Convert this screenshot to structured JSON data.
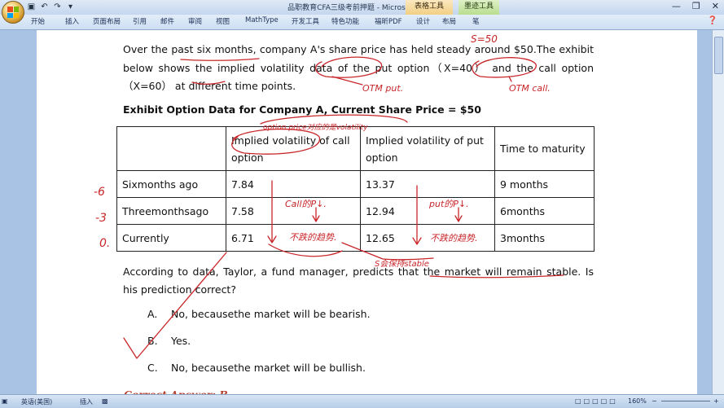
{
  "window": {
    "title": "品职教育CFA三级考前押题 - Microsoft Word",
    "contextual_tabs": [
      "表格工具",
      "墨迹工具"
    ]
  },
  "ribbon": {
    "tabs": [
      "开始",
      "插入",
      "页面布局",
      "引用",
      "邮件",
      "审阅",
      "视图",
      "MathType",
      "开发工具",
      "特色功能",
      "福昕PDF",
      "设计",
      "布局",
      "笔"
    ]
  },
  "document": {
    "para1": "Over the past six months, company A's share price has held steady around $50.The exhibit below shows the implied volatility data of the put option（X=40） and the call option（X=60） at different time points.",
    "exhibit_title": "Exhibit Option Data for Company A, Current Share Price = $50",
    "table": {
      "headers": [
        "",
        "Implied volatility of call option",
        "Implied volatility of put option",
        "Time to maturity"
      ],
      "rows": [
        [
          "Sixmonths ago",
          "7.84",
          "13.37",
          "9 months"
        ],
        [
          "Threemonthsago",
          "7.58",
          "12.94",
          "6months"
        ],
        [
          "Currently",
          "6.71",
          "12.65",
          "3months"
        ]
      ]
    },
    "question": "According to data, Taylor, a fund manager, predicts that the market will remain stable. Is his prediction correct?",
    "options": [
      {
        "label": "A.",
        "text": "No, becausethe market will be bearish."
      },
      {
        "label": "B.",
        "text": "Yes."
      },
      {
        "label": "C.",
        "text": "No, becausethe market will be bullish."
      }
    ],
    "answer": "Correct Answer: B"
  },
  "annotations": {
    "s_eq_50": "S=50",
    "otm_put": "OTM put.",
    "otm_call": "OTM call.",
    "header_note": "option price对应的是volatility",
    "call_note": "Call的P↓.",
    "put_note": "put的P↓.",
    "call_conclusion": "不跌的趋势.",
    "put_conclusion": "不跌的趋势.",
    "s_stable": "S会保持stable",
    "minus6": "-6",
    "minus3": "-3",
    "zero": "0."
  },
  "statusbar": {
    "language": "英语(美国)",
    "mode": "插入",
    "zoom": "160%"
  },
  "colors": {
    "ink": "#c8262a",
    "answer": "#b5412f"
  }
}
